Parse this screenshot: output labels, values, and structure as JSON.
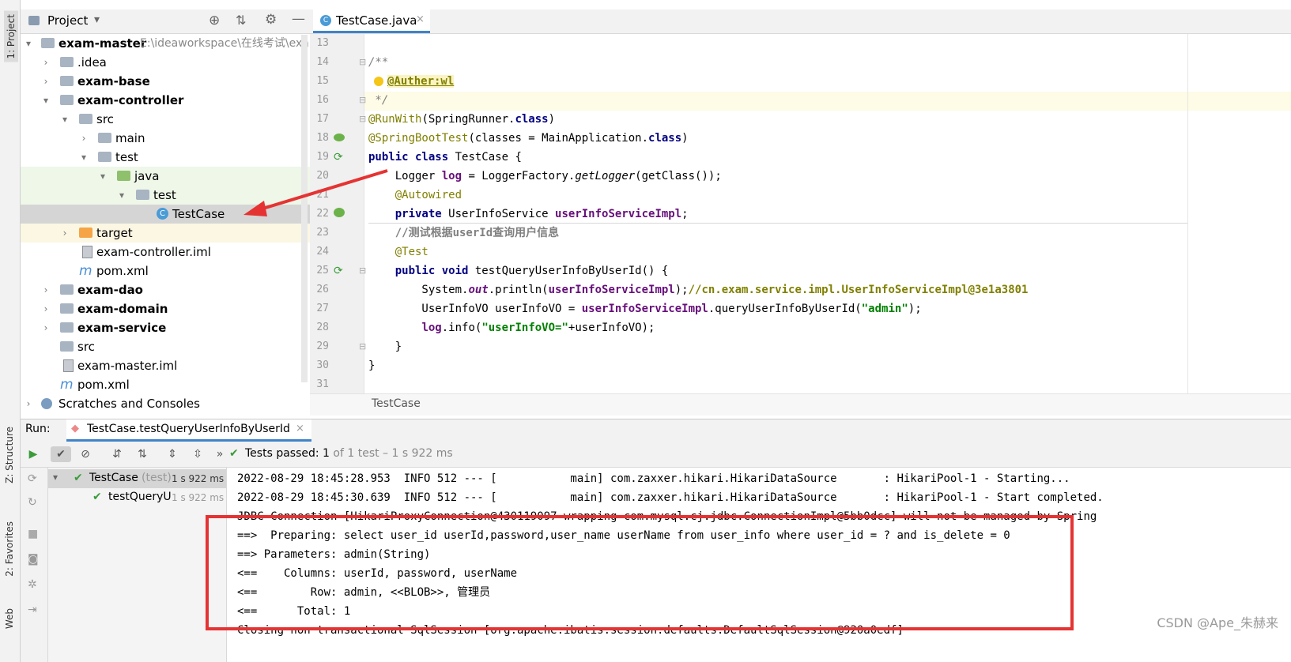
{
  "left_strip": {
    "project_tab": "1: Project",
    "structure_tab": "Z: Structure",
    "favorites_tab": "2: Favorites",
    "web_tab": "Web"
  },
  "project_panel": {
    "title": "Project",
    "tree": [
      {
        "label": "exam-master",
        "path": "E:\\ideaworkspace\\在线考试\\exa",
        "bold": true
      },
      {
        "label": ".idea"
      },
      {
        "label": "exam-base",
        "bold": true
      },
      {
        "label": "exam-controller",
        "bold": true
      },
      {
        "label": "src"
      },
      {
        "label": "main"
      },
      {
        "label": "test"
      },
      {
        "label": "java"
      },
      {
        "label": "test"
      },
      {
        "label": "TestCase"
      },
      {
        "label": "target"
      },
      {
        "label": "exam-controller.iml"
      },
      {
        "label": "pom.xml"
      },
      {
        "label": "exam-dao",
        "bold": true
      },
      {
        "label": "exam-domain",
        "bold": true
      },
      {
        "label": "exam-service",
        "bold": true
      },
      {
        "label": "src"
      },
      {
        "label": "exam-master.iml"
      },
      {
        "label": "pom.xml"
      },
      {
        "label": "Scratches and Consoles"
      }
    ]
  },
  "editor": {
    "tab_label": "TestCase.java",
    "breadcrumb": "TestCase",
    "line_numbers": [
      "13",
      "14",
      "15",
      "16",
      "17",
      "18",
      "19",
      "20",
      "21",
      "22",
      "23",
      "24",
      "25",
      "26",
      "27",
      "28",
      "29",
      "30",
      "31"
    ],
    "code": {
      "l14": "/**",
      "l15": "@Auther:wl",
      "l16": " */",
      "l17a": "@RunWith",
      "l17b": "(SpringRunner.",
      "l17c": "class",
      "l17d": ")",
      "l18a": "@SpringBootTest",
      "l18b": "(classes = MainApplication.",
      "l18c": "class",
      "l18d": ")",
      "l19a": "public class",
      "l19b": " TestCase {",
      "l20a": "    Logger ",
      "l20b": "log",
      "l20c": " = LoggerFactory.",
      "l20d": "getLogger",
      "l20e": "(getClass());",
      "l21": "    @Autowired",
      "l22a": "    private",
      "l22b": " UserInfoService ",
      "l22c": "userInfoServiceImpl",
      "l22d": ";",
      "l23": "    //测试根据userId查询用户信息",
      "l24": "    @Test",
      "l25a": "    public void",
      "l25b": " testQueryUserInfoByUserId() {",
      "l26a": "        System.",
      "l26b": "out",
      "l26c": ".println(",
      "l26d": "userInfoServiceImpl",
      "l26e": ");",
      "l26f": "//cn.exam.service.impl.UserInfoServiceImpl@3e1a3801",
      "l27a": "        UserInfoVO userInfoVO = ",
      "l27b": "userInfoServiceImpl",
      "l27c": ".queryUserInfoByUserId(",
      "l27d": "\"admin\"",
      "l27e": ");",
      "l28a": "        ",
      "l28b": "log",
      "l28c": ".info(",
      "l28d": "\"userInfoVO=\"",
      "l28e": "+userInfoVO);",
      "l29": "    }",
      "l30": "}"
    }
  },
  "run_panel": {
    "run_label": "Run:",
    "run_tab": "TestCase.testQueryUserInfoByUserId",
    "status_prefix": "Tests passed: ",
    "status_count": "1",
    "status_suffix": " of 1 test – 1 s 922 ms",
    "tree_root": "TestCase",
    "tree_root_pkg": "(test)",
    "tree_root_time": "1 s 922 ms",
    "tree_child": "testQueryU",
    "tree_child_time": "1 s 922 ms",
    "console_lines": [
      "2022-08-29 18:45:28.953  INFO 512 --- [           main] com.zaxxer.hikari.HikariDataSource       : HikariPool-1 - Starting...",
      "2022-08-29 18:45:30.639  INFO 512 --- [           main] com.zaxxer.hikari.HikariDataSource       : HikariPool-1 - Start completed.",
      "JDBC Connection [HikariProxyConnection@430119097 wrapping com.mysql.cj.jdbc.ConnectionImpl@5bb0dcc] will not be managed by Spring",
      "==>  Preparing: select user_id userId,password,user_name userName from user_info where user_id = ? and is_delete = 0",
      "==> Parameters: admin(String)",
      "<==    Columns: userId, password, userName",
      "<==        Row: admin, <<BLOB>>, 管理员",
      "<==      Total: 1",
      "Closing non transactional SqlSession [org.apache.ibatis.session.defaults.DefaultSqlSession@920a0edf]"
    ]
  },
  "watermark": "CSDN @Ape_朱赫来",
  "colors": {
    "annotation_red": "#e53333",
    "pass_green": "#3a9b3a"
  }
}
